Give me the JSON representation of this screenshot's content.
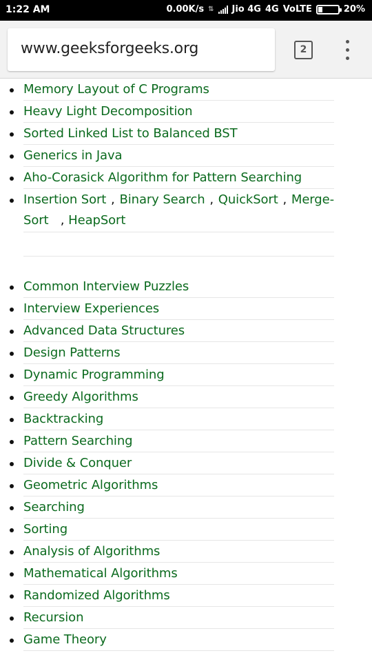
{
  "status_bar": {
    "time": "1:22 AM",
    "net_speed": "0.00K/s",
    "carrier": "Jio 4G",
    "network": "4G",
    "volte": "VoLTE",
    "battery": "20%",
    "battery_level": 0.2
  },
  "browser": {
    "url": "www.geeksforgeeks.org",
    "tab_count": "2",
    "menu_icon": "overflow-menu-icon"
  },
  "list1": [
    "Memory Layout of C Programs",
    "Heavy Light Decomposition",
    "Sorted Linked List to Balanced BST",
    "Generics in Java",
    "Aho-Corasick Algorithm for Pattern Searching"
  ],
  "multi_item": {
    "link1": "Insertion Sort",
    "link2": "Binary Search",
    "link3": "QuickSort",
    "link4a": "Merge-",
    "link4b": "Sort",
    "link5": "HeapSort",
    "separator": ","
  },
  "list2": [
    "Common Interview Puzzles",
    "Interview Experiences",
    "Advanced Data Structures",
    "Design Patterns",
    "Dynamic Programming",
    "Greedy Algorithms",
    "Backtracking",
    "Pattern Searching",
    "Divide & Conquer",
    "Geometric Algorithms",
    "Searching",
    "Sorting",
    "Analysis of Algorithms",
    "Mathematical Algorithms",
    "Randomized Algorithms",
    "Recursion",
    "Game Theory"
  ],
  "colors": {
    "link": "#0b6a1e",
    "status_bar": "#000000",
    "toolbar": "#f2f2f2"
  }
}
